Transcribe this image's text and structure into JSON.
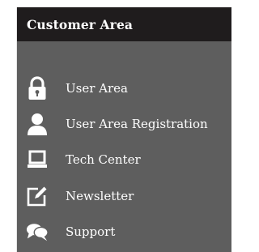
{
  "panel": {
    "title": "Customer Area",
    "items": [
      {
        "label": "User Area",
        "icon": "lock-icon"
      },
      {
        "label": "User Area Registration",
        "icon": "user-icon"
      },
      {
        "label": "Tech Center",
        "icon": "laptop-icon"
      },
      {
        "label": "Newsletter",
        "icon": "edit-icon"
      },
      {
        "label": "Support",
        "icon": "chat-bubbles-icon"
      }
    ],
    "colors": {
      "header_bg": "#1f1c1d",
      "panel_bg": "#5e5e5e",
      "text": "#ffffff"
    }
  }
}
